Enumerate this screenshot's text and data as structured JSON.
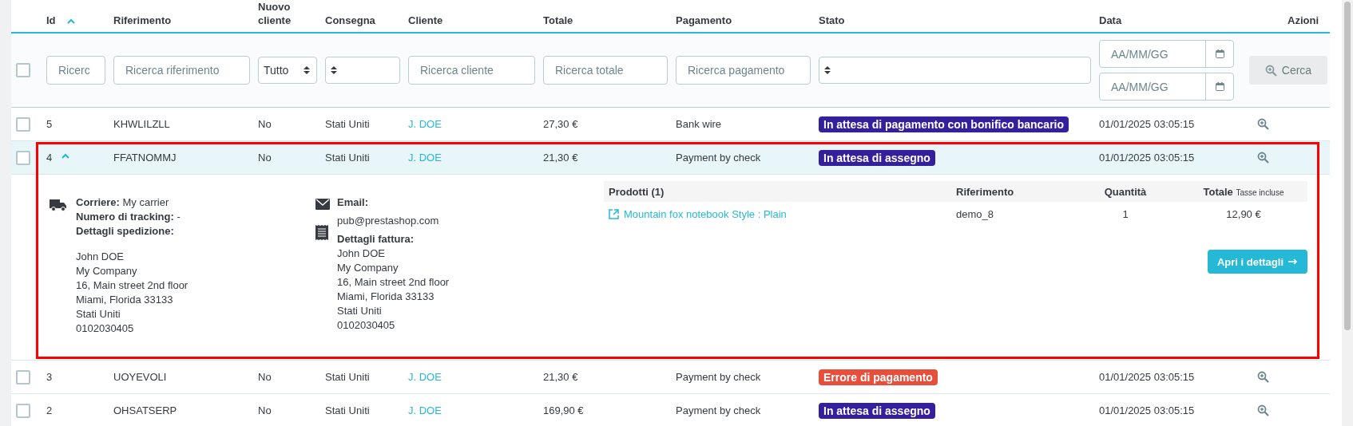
{
  "columns": [
    {
      "label": "Id",
      "sorted": true
    },
    {
      "label": "Riferimento",
      "sorted": false
    },
    {
      "label": "Nuovo cliente",
      "sorted": false
    },
    {
      "label": "Consegna",
      "sorted": false
    },
    {
      "label": "Cliente",
      "sorted": false
    },
    {
      "label": "Totale",
      "sorted": false
    },
    {
      "label": "Pagamento",
      "sorted": false
    },
    {
      "label": "Stato",
      "sorted": false
    },
    {
      "label": "Data",
      "sorted": false
    },
    {
      "label": "Azioni",
      "sorted": false
    }
  ],
  "filters": [
    {
      "kind": "checkbox",
      "checked": false
    },
    {
      "kind": "text",
      "placeholder": "Ricerc"
    },
    {
      "kind": "text",
      "placeholder": "Ricerca riferimento"
    },
    {
      "kind": "select",
      "value": "Tutto"
    },
    {
      "kind": "select"
    },
    {
      "kind": "text",
      "placeholder": "Ricerca cliente"
    },
    {
      "kind": "text",
      "placeholder": "Ricerca totale"
    },
    {
      "kind": "text",
      "placeholder": "Ricerca pagamento"
    },
    {
      "kind": "select"
    },
    {
      "kind": "daterange",
      "from_placeholder": "AA/MM/GG",
      "to_placeholder": "AA/MM/GG"
    },
    {
      "kind": "button",
      "label": "Cerca",
      "disabled": true
    }
  ],
  "rows": [
    {
      "checked": false,
      "id": "5",
      "reference": "KHWLILZLL",
      "new_customer": "No",
      "delivery": "Stati Uniti",
      "customer": "J. DOE",
      "total": "27,30 €",
      "payment": "Bank wire",
      "status": {
        "label": "In attesa di pagamento con bonifico bancario",
        "color": "#34209e"
      },
      "date": "01/01/2025 03:05:15",
      "expanded": false
    },
    {
      "checked": false,
      "id": "4",
      "reference": "FFATNOMMJ",
      "new_customer": "No",
      "delivery": "Stati Uniti",
      "customer": "J. DOE",
      "total": "21,30 €",
      "payment": "Payment by check",
      "status": {
        "label": "In attesa di assegno",
        "color": "#34209e"
      },
      "date": "01/01/2025 03:05:15",
      "expanded": true,
      "highlighted": true,
      "details": {
        "shipping": {
          "carrier": "**Corriere:** My carrier",
          "tracking": "**Numero di tracking:** -",
          "address_label": "Dettagli spedizione:",
          "address": [
            "John DOE",
            "My Company",
            "16, Main street 2nd floor",
            "Miami, Florida 33133",
            "Stati Uniti",
            "0102030405"
          ]
        },
        "billing": {
          "email_label": "Email:",
          "email": "pub@prestashop.com",
          "invoice_label": "Dettagli fattura:",
          "address": [
            "John DOE",
            "My Company",
            "16, Main street 2nd floor",
            "Miami, Florida 33133",
            "Stati Uniti",
            "0102030405"
          ]
        },
        "products": {
          "columns": [
            "Prodotti (1)",
            "Riferimento",
            "Quantità",
            "Totale"
          ],
          "total_note": "Tasse incluse",
          "items": [
            {
              "name": "Mountain fox notebook Style : Plain",
              "reference": "demo_8",
              "quantity": "1",
              "total": "12,90 €"
            }
          ]
        },
        "button": "Apri i dettagli"
      }
    },
    {
      "checked": false,
      "id": "3",
      "reference": "UOYEVOLI",
      "new_customer": "No",
      "delivery": "Stati Uniti",
      "customer": "J. DOE",
      "total": "21,30 €",
      "payment": "Payment by check",
      "status": {
        "label": "Errore di pagamento",
        "color": "#e84e3c"
      },
      "date": "01/01/2025 03:05:15",
      "expanded": false
    },
    {
      "checked": false,
      "id": "2",
      "reference": "OHSATSERP",
      "new_customer": "No",
      "delivery": "Stati Uniti",
      "customer": "J. DOE",
      "total": "169,90 €",
      "payment": "Payment by check",
      "status": {
        "label": "In attesa di assegno",
        "color": "#34209e"
      },
      "date": "01/01/2025 03:05:15",
      "expanded": false
    }
  ]
}
